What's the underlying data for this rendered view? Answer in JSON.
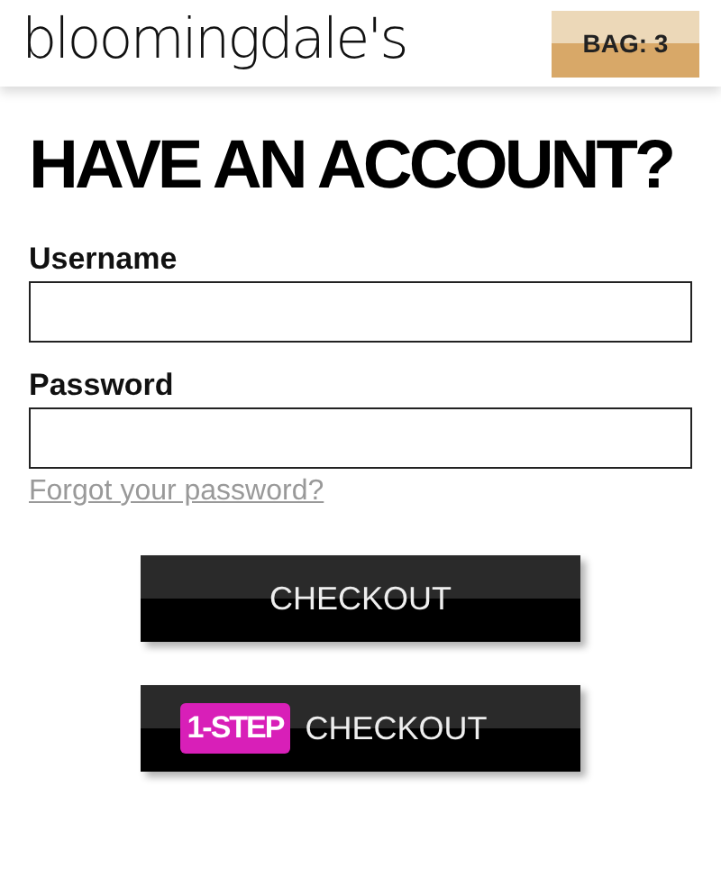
{
  "header": {
    "logo": "bloomingdale's",
    "bag_button": "BAG: 3"
  },
  "heading": "HAVE AN ACCOUNT?",
  "fields": [
    {
      "label": "Username"
    },
    {
      "label": "Password"
    }
  ],
  "forgot_link": "Forgot your password?",
  "buttons": [
    {
      "kind": "plain",
      "label": "CHECKOUT"
    },
    {
      "kind": "one_step",
      "badge": "1-STEP",
      "label": "CHECKOUT"
    }
  ]
}
